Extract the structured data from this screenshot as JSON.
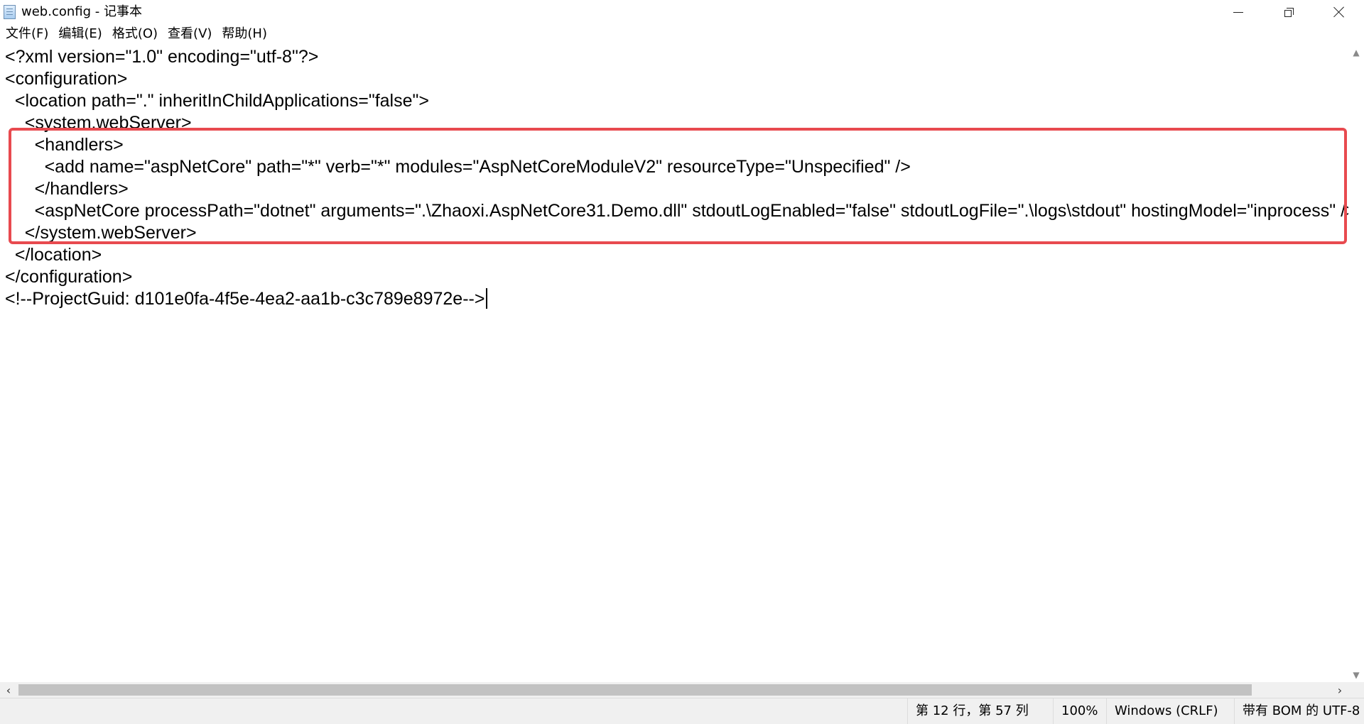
{
  "window": {
    "title": "web.config - 记事本"
  },
  "menu": {
    "items": [
      "文件(F)",
      "编辑(E)",
      "格式(O)",
      "查看(V)",
      "帮助(H)"
    ]
  },
  "editor": {
    "lines": [
      "<?xml version=\"1.0\" encoding=\"utf-8\"?>",
      "<configuration>",
      "  <location path=\".\" inheritInChildApplications=\"false\">",
      "    <system.webServer>",
      "      <handlers>",
      "        <add name=\"aspNetCore\" path=\"*\" verb=\"*\" modules=\"AspNetCoreModuleV2\" resourceType=\"Unspecified\" />",
      "      </handlers>",
      "      <aspNetCore processPath=\"dotnet\" arguments=\".\\Zhaoxi.AspNetCore31.Demo.dll\" stdoutLogEnabled=\"false\" stdoutLogFile=\".\\logs\\stdout\" hostingModel=\"inprocess\" />",
      "    </system.webServer>",
      "  </location>",
      "</configuration>",
      "<!--ProjectGuid: d101e0fa-4f5e-4ea2-aa1b-c3c789e8972e-->"
    ],
    "caret_line": 12,
    "highlight_color": "#e84a4f"
  },
  "statusbar": {
    "position": "第 12 行，第 57 列",
    "zoom": "100%",
    "line_ending": "Windows (CRLF)",
    "encoding": "带有 BOM 的 UTF-8"
  }
}
